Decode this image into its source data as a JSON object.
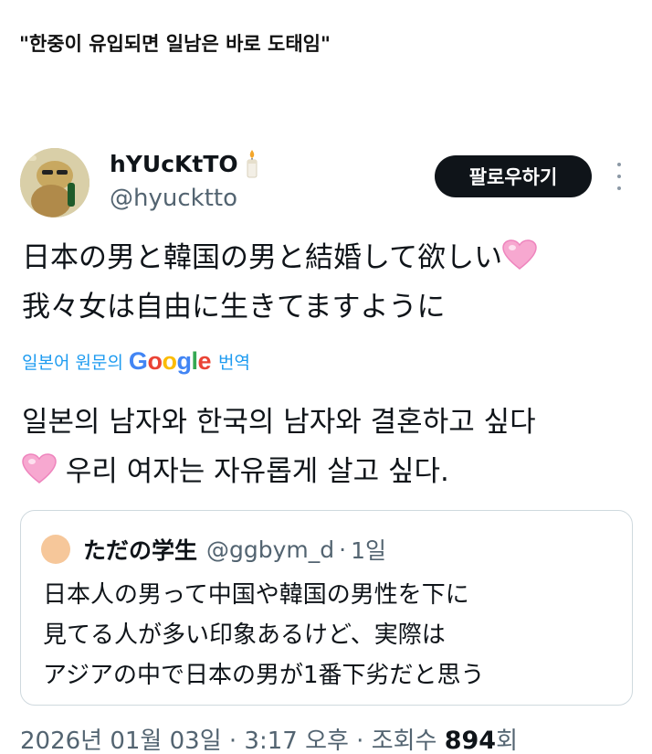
{
  "headline": "\"한중이 유입되면 일남은 바로 도태임\"",
  "tweet": {
    "display_name": "hYUcKtTO",
    "handle": "@hyucktto",
    "follow_label": "팔로우하기",
    "text_jp_line1": "日本の男と韓国の男と結婚して欲しい",
    "text_jp_line2": "我々女は自由に生きてますように",
    "translate_prefix": "일본어 원문의",
    "translate_suffix": "번역",
    "text_ko_line1": "일본의 남자와 한국의 남자와 결혼하고 싶다",
    "text_ko_line2": "우리 여자는 자유롭게 살고 싶다."
  },
  "quote": {
    "name": "ただの学生",
    "handle": "@ggbym_d",
    "separator": "·",
    "time": "1일",
    "line1": "日本人の男って中国や韓国の男性を下に",
    "line2": "見てる人が多い印象あるけど、実際は",
    "line3": "アジアの中で日本の男が1番下劣だと思う"
  },
  "meta": {
    "prefix": "2026년 01월 03일 · 3:17 오후 · 조회수 ",
    "views": "894",
    "suffix": "회"
  },
  "icons": {
    "candle": "candle-icon",
    "heart": "pink-heart-emoji",
    "more": "more-vertical-icon"
  },
  "colors": {
    "link_blue": "#1d9bf0",
    "secondary_text": "#536471",
    "follow_button": "#0f1419",
    "heart_pink": "#f7a8d0"
  }
}
